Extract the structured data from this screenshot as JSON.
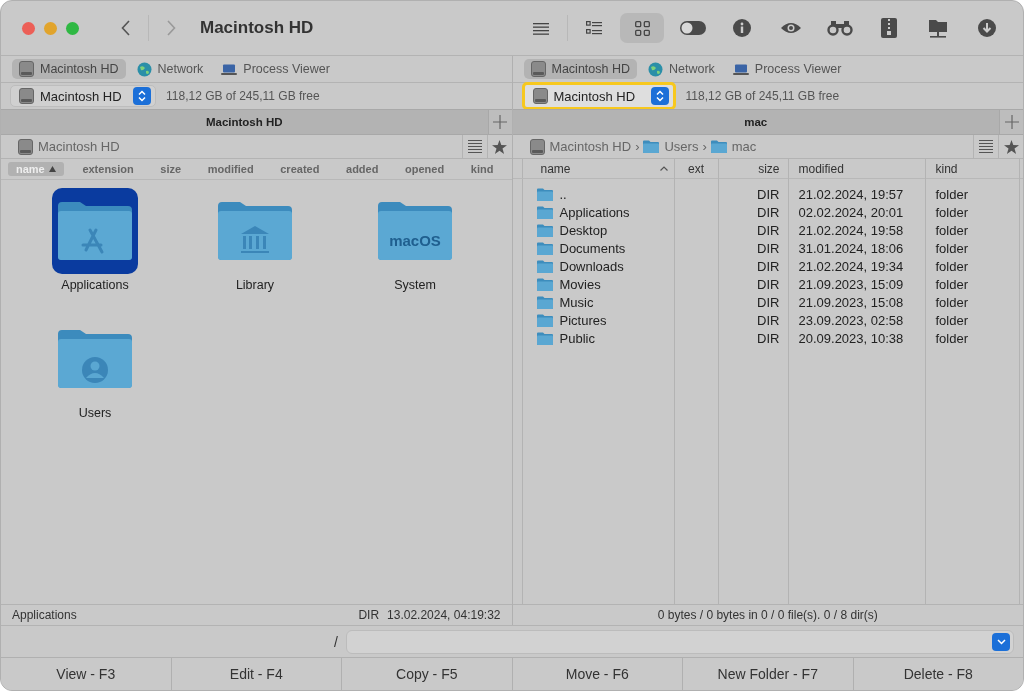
{
  "window": {
    "title": "Macintosh HD"
  },
  "view_modes": [
    {
      "kind": "list",
      "selected": false
    },
    {
      "kind": "details",
      "selected": false
    },
    {
      "kind": "grid",
      "selected": true
    }
  ],
  "tools": [
    {
      "kind": "toggle"
    },
    {
      "kind": "info"
    },
    {
      "kind": "eye"
    },
    {
      "kind": "binoculars"
    },
    {
      "kind": "archive"
    },
    {
      "kind": "network-folder"
    },
    {
      "kind": "download"
    }
  ],
  "panels": [
    {
      "tabs": [
        {
          "label": "Macintosh HD",
          "kind": "drive",
          "selected": true
        },
        {
          "label": "Network",
          "kind": "network",
          "selected": false
        },
        {
          "label": "Process Viewer",
          "kind": "laptop",
          "selected": false
        }
      ],
      "drive": {
        "label": "Macintosh HD",
        "focused": false
      },
      "free_space": "118,12 GB of 245,11 GB free",
      "header": "Macintosh HD",
      "path": [
        {
          "label": "Macintosh HD",
          "kind": "drive"
        }
      ],
      "columns": [
        {
          "label": "name",
          "sorted": true
        },
        {
          "label": "extension",
          "sorted": false
        },
        {
          "label": "size",
          "sorted": false
        },
        {
          "label": "modified",
          "sorted": false
        },
        {
          "label": "created",
          "sorted": false
        },
        {
          "label": "added",
          "sorted": false
        },
        {
          "label": "opened",
          "sorted": false
        },
        {
          "label": "kind",
          "sorted": false
        }
      ],
      "items": [
        {
          "name": "Applications",
          "kind": "apps",
          "selected": true
        },
        {
          "name": "Library",
          "kind": "library",
          "selected": false
        },
        {
          "name": "System",
          "kind": "system",
          "icon_text": "macOS",
          "selected": false
        },
        {
          "name": "Users",
          "kind": "users",
          "selected": false
        }
      ],
      "status": {
        "name": "Applications",
        "size": "DIR",
        "date": "13.02.2024, 04:19:32"
      }
    },
    {
      "tabs": [
        {
          "label": "Macintosh HD",
          "kind": "drive",
          "selected": true
        },
        {
          "label": "Network",
          "kind": "network",
          "selected": false
        },
        {
          "label": "Process Viewer",
          "kind": "laptop",
          "selected": false
        }
      ],
      "drive": {
        "label": "Macintosh HD",
        "focused": true
      },
      "free_space": "118,12 GB of 245,11 GB free",
      "header": "mac",
      "path_separator": "›",
      "path": [
        {
          "label": "Macintosh HD",
          "kind": "drive"
        },
        {
          "label": "Users",
          "kind": "folder"
        },
        {
          "label": "mac",
          "kind": "folder"
        }
      ],
      "columns": [
        {
          "label": "name",
          "sorted": true
        },
        {
          "label": "ext",
          "sorted": false
        },
        {
          "label": "size",
          "sorted": false
        },
        {
          "label": "modified",
          "sorted": false
        },
        {
          "label": "kind",
          "sorted": false
        }
      ],
      "rows": [
        {
          "name": "..",
          "size": "DIR",
          "modified": "21.02.2024, 19:57",
          "kind": "folder"
        },
        {
          "name": "Applications",
          "size": "DIR",
          "modified": "02.02.2024, 20:01",
          "kind": "folder"
        },
        {
          "name": "Desktop",
          "size": "DIR",
          "modified": "21.02.2024, 19:58",
          "kind": "folder"
        },
        {
          "name": "Documents",
          "size": "DIR",
          "modified": "31.01.2024, 18:06",
          "kind": "folder"
        },
        {
          "name": "Downloads",
          "size": "DIR",
          "modified": "21.02.2024, 19:34",
          "kind": "folder"
        },
        {
          "name": "Movies",
          "size": "DIR",
          "modified": "21.09.2023, 15:09",
          "kind": "folder"
        },
        {
          "name": "Music",
          "size": "DIR",
          "modified": "21.09.2023, 15:08",
          "kind": "folder"
        },
        {
          "name": "Pictures",
          "size": "DIR",
          "modified": "23.09.2023, 02:58",
          "kind": "folder"
        },
        {
          "name": "Public",
          "size": "DIR",
          "modified": "20.09.2023, 10:38",
          "kind": "folder"
        }
      ],
      "status": {
        "summary": "0 bytes / 0 bytes in 0 / 0 file(s). 0 / 8 dir(s)"
      }
    }
  ],
  "command_line": {
    "prompt": "/"
  },
  "function_keys": [
    "View - F3",
    "Edit - F4",
    "Copy - F5",
    "Move - F6",
    "New Folder - F7",
    "Delete - F8"
  ]
}
